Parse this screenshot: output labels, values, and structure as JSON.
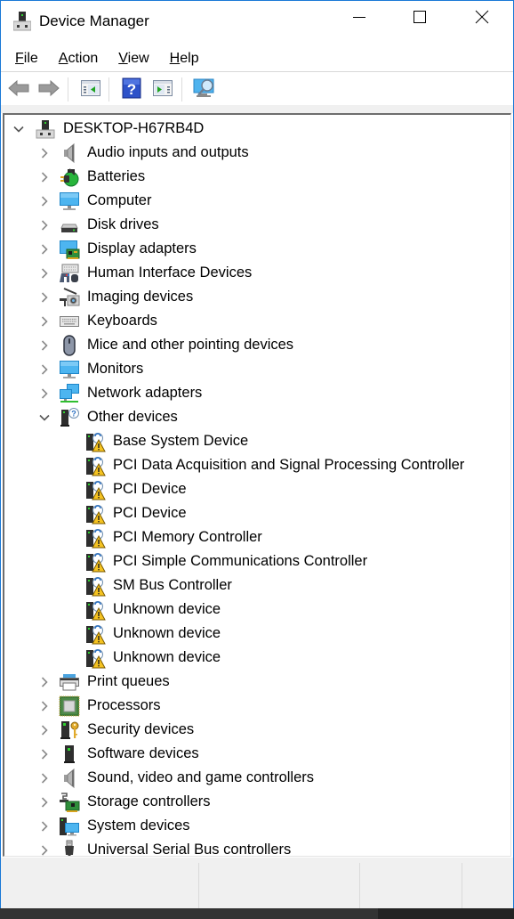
{
  "window": {
    "title": "Device Manager",
    "controls": {
      "minimize": "minimize",
      "maximize": "maximize",
      "close": "close"
    }
  },
  "menu": [
    {
      "label": "File",
      "accel": "F",
      "rest": "ile"
    },
    {
      "label": "Action",
      "accel": "A",
      "rest": "ction"
    },
    {
      "label": "View",
      "accel": "V",
      "rest": "iew"
    },
    {
      "label": "Help",
      "accel": "H",
      "rest": "elp"
    }
  ],
  "toolbar": [
    {
      "name": "back",
      "icon": "back-arrow-icon",
      "enabled": false
    },
    {
      "name": "forward",
      "icon": "forward-arrow-icon",
      "enabled": false
    },
    {
      "name": "show-hide-console-tree",
      "icon": "console-tree-icon",
      "enabled": true
    },
    {
      "name": "help",
      "icon": "help-icon",
      "enabled": true
    },
    {
      "name": "show-hide-action-pane",
      "icon": "action-pane-icon",
      "enabled": true
    },
    {
      "name": "scan-for-hardware-changes",
      "icon": "scan-hardware-icon",
      "enabled": true
    }
  ],
  "tree": {
    "root": {
      "label": "DESKTOP-H67RB4D",
      "expanded": true,
      "icon": "computer-root-icon"
    },
    "categories": [
      {
        "label": "Audio inputs and outputs",
        "icon": "speaker-icon",
        "expanded": false
      },
      {
        "label": "Batteries",
        "icon": "battery-icon",
        "expanded": false
      },
      {
        "label": "Computer",
        "icon": "monitor-icon",
        "expanded": false
      },
      {
        "label": "Disk drives",
        "icon": "disk-drive-icon",
        "expanded": false
      },
      {
        "label": "Display adapters",
        "icon": "display-adapter-icon",
        "expanded": false
      },
      {
        "label": "Human Interface Devices",
        "icon": "hid-icon",
        "expanded": false
      },
      {
        "label": "Imaging devices",
        "icon": "camera-icon",
        "expanded": false
      },
      {
        "label": "Keyboards",
        "icon": "keyboard-icon",
        "expanded": false
      },
      {
        "label": "Mice and other pointing devices",
        "icon": "mouse-icon",
        "expanded": false
      },
      {
        "label": "Monitors",
        "icon": "monitor-icon",
        "expanded": false
      },
      {
        "label": "Network adapters",
        "icon": "network-icon",
        "expanded": false
      },
      {
        "label": "Other devices",
        "icon": "unknown-device-icon",
        "expanded": true,
        "children": [
          {
            "label": "Base System Device",
            "icon": "warning-device-icon"
          },
          {
            "label": "PCI Data Acquisition and Signal Processing Controller",
            "icon": "warning-device-icon"
          },
          {
            "label": "PCI Device",
            "icon": "warning-device-icon"
          },
          {
            "label": "PCI Device",
            "icon": "warning-device-icon"
          },
          {
            "label": "PCI Memory Controller",
            "icon": "warning-device-icon"
          },
          {
            "label": "PCI Simple Communications Controller",
            "icon": "warning-device-icon"
          },
          {
            "label": "SM Bus Controller",
            "icon": "warning-device-icon"
          },
          {
            "label": "Unknown device",
            "icon": "warning-device-icon"
          },
          {
            "label": "Unknown device",
            "icon": "warning-device-icon"
          },
          {
            "label": "Unknown device",
            "icon": "warning-device-icon"
          }
        ]
      },
      {
        "label": "Print queues",
        "icon": "printer-icon",
        "expanded": false
      },
      {
        "label": "Processors",
        "icon": "processor-icon",
        "expanded": false
      },
      {
        "label": "Security devices",
        "icon": "security-device-icon",
        "expanded": false
      },
      {
        "label": "Software devices",
        "icon": "software-device-icon",
        "expanded": false
      },
      {
        "label": "Sound, video and game controllers",
        "icon": "speaker-icon",
        "expanded": false
      },
      {
        "label": "Storage controllers",
        "icon": "storage-controller-icon",
        "expanded": false
      },
      {
        "label": "System devices",
        "icon": "system-devices-icon",
        "expanded": false
      },
      {
        "label": "Universal Serial Bus controllers",
        "icon": "usb-icon",
        "expanded": false
      }
    ]
  },
  "statusbar": {
    "panels": [
      "",
      "",
      ""
    ]
  },
  "colors": {
    "window_border": "#1a79d6",
    "chrome_bg": "#f0f0f0",
    "text": "#000000",
    "chevron": "#8a8a8a"
  }
}
